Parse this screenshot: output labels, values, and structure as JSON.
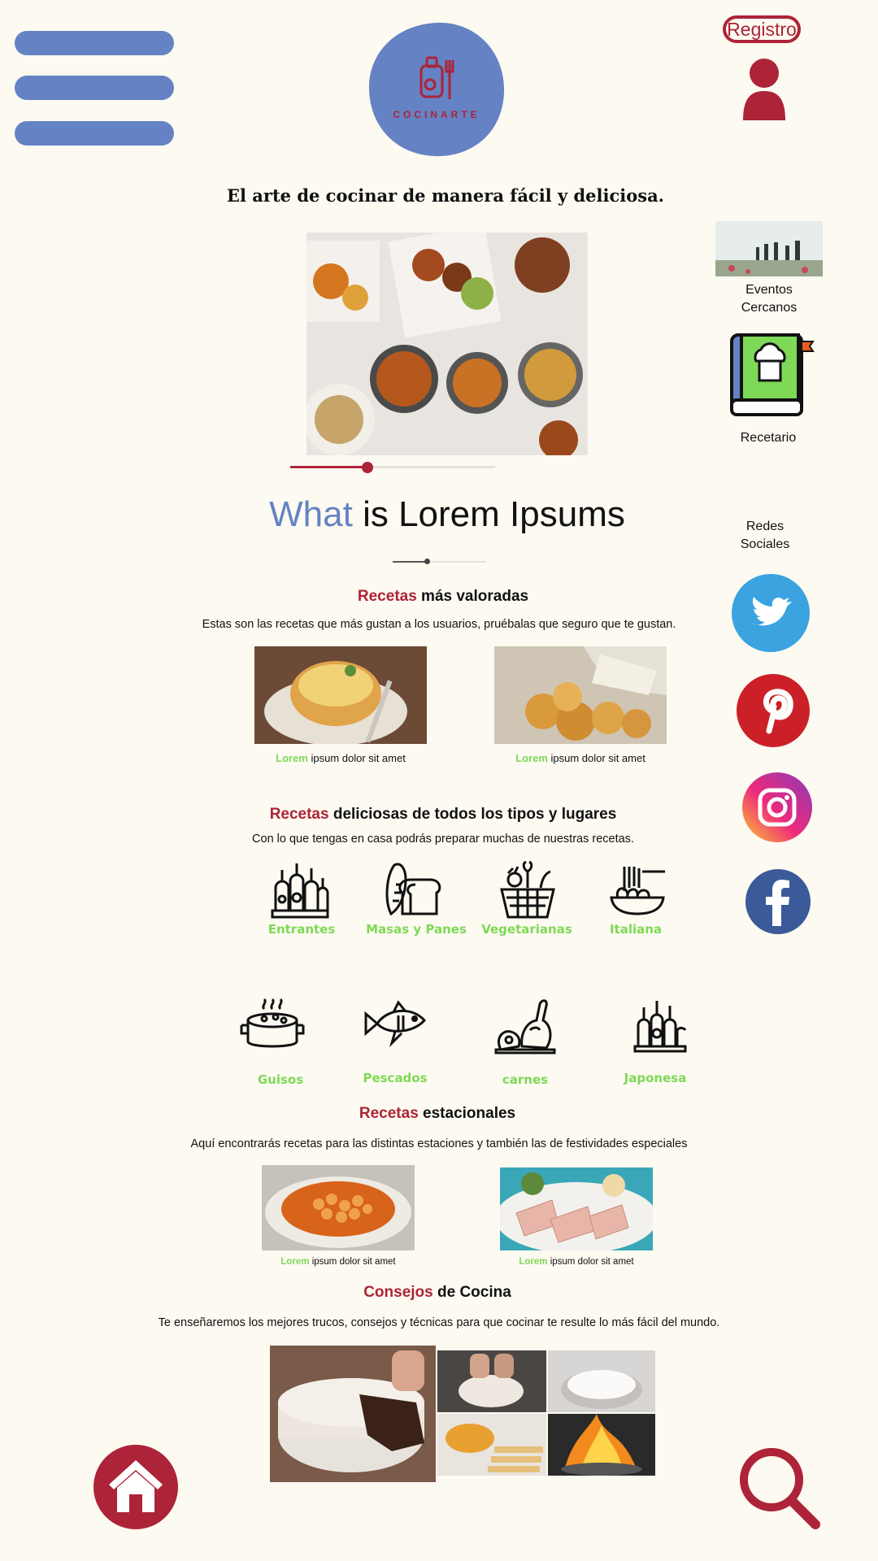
{
  "brand": {
    "logo_text": "COCINARTE"
  },
  "header": {
    "register_label": "Registro"
  },
  "tagline": "El arte de cocinar de manera fácil y deliciosa.",
  "hero": {
    "slider_progress": 0.375
  },
  "what": {
    "highlight": "What",
    "rest": " is Lorem Ipsums"
  },
  "side": {
    "events_line1": "Eventos",
    "events_line2": "Cercanos",
    "recipes_label": "Recetario",
    "social_line1": "Redes",
    "social_line2": "Sociales"
  },
  "top_rated": {
    "title_accent": "Recetas",
    "title_rest": " más valoradas",
    "description": "Estas son las recetas que más gustan a los usuarios, pruébalas que seguro que te gustan.",
    "cards": [
      {
        "accent": "Lorem",
        "text": " ipsum dolor sit amet"
      },
      {
        "accent": "Lorem",
        "text": " ipsum dolor sit amet"
      }
    ]
  },
  "all_types": {
    "title_accent": "Recetas",
    "title_rest": " deliciosas de todos los tipos y lugares",
    "description": "Con lo que tengas en casa podrás preparar muchas de nuestras recetas.",
    "categories": [
      "Entrantes",
      "Masas y Panes",
      "Vegetarianas",
      "Italiana",
      "Guisos",
      "Pescados",
      "carnes",
      "Japonesa"
    ]
  },
  "seasonal": {
    "title_accent": "Recetas",
    "title_rest": " estacionales",
    "description": "Aquí encontrarás recetas para las distintas estaciones y también las de festividades especiales",
    "cards": [
      {
        "accent": "Lorem",
        "text": " ipsum dolor sit amet"
      },
      {
        "accent": "Lorem",
        "text": " ipsum dolor sit amet"
      }
    ]
  },
  "tips": {
    "title_accent": "Consejos",
    "title_rest": " de Cocina",
    "description": "Te enseñaremos los mejores trucos, consejos y  técnicas para que cocinar te resulte lo más fácil del mundo."
  },
  "colors": {
    "accent_red": "#ad2337",
    "accent_blue": "#6583c4",
    "accent_green": "#7ed957",
    "background": "#fdfaf1"
  },
  "icons": [
    "menu-icon",
    "user-icon",
    "twitter-icon",
    "pinterest-icon",
    "instagram-icon",
    "facebook-icon",
    "home-icon",
    "search-icon",
    "recipe-book-icon"
  ]
}
